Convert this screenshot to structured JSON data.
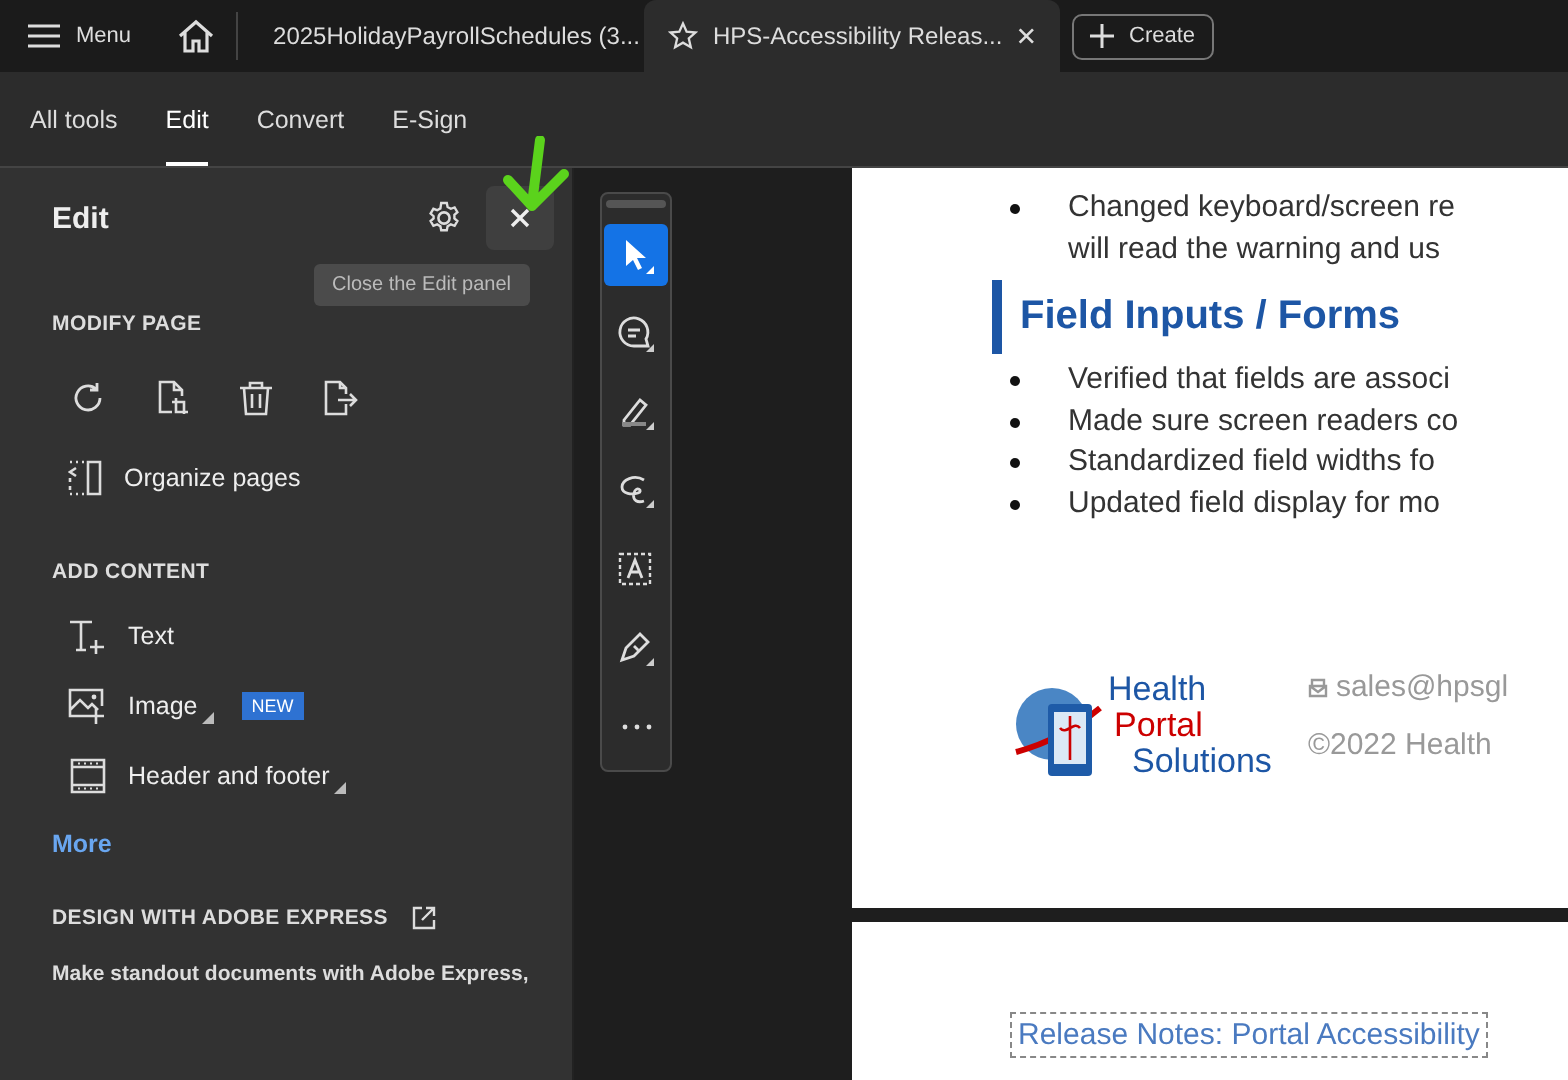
{
  "top_bar": {
    "menu": "Menu",
    "tabs": [
      {
        "label": "2025HolidayPayrollSchedules (3...",
        "selected": false
      },
      {
        "label": "HPS-Accessibility Releas...",
        "selected": true
      }
    ],
    "create": "Create"
  },
  "nav": [
    {
      "label": "All tools",
      "selected": false
    },
    {
      "label": "Edit",
      "selected": true
    },
    {
      "label": "Convert",
      "selected": false
    },
    {
      "label": "E-Sign",
      "selected": false
    }
  ],
  "panel": {
    "title": "Edit",
    "tooltip": "Close the Edit panel",
    "modify_heading": "MODIFY PAGE",
    "modify_tools": [
      {
        "kind": "rotate"
      },
      {
        "kind": "crop"
      },
      {
        "kind": "delete"
      },
      {
        "kind": "extract"
      }
    ],
    "organize": "Organize pages",
    "add_heading": "ADD CONTENT",
    "add_items": [
      {
        "kind": "text",
        "label": "Text",
        "caret": false
      },
      {
        "kind": "image",
        "label": "Image",
        "caret": true,
        "badge": "NEW"
      },
      {
        "kind": "header-footer",
        "label": "Header and footer",
        "caret": true
      }
    ],
    "more": "More",
    "express_heading": "DESIGN WITH ADOBE EXPRESS",
    "express_text": "Make standout documents with Adobe Express,"
  },
  "tools": [
    {
      "kind": "select",
      "selected": true
    },
    {
      "kind": "comment",
      "selected": false
    },
    {
      "kind": "highlight",
      "selected": false
    },
    {
      "kind": "draw",
      "selected": false
    },
    {
      "kind": "text-select",
      "selected": false
    },
    {
      "kind": "sign",
      "selected": false
    },
    {
      "kind": "more",
      "selected": false
    }
  ],
  "document": {
    "top_lines": [
      "Changed keyboard/screen re",
      "will read the warning and us"
    ],
    "heading": "Field Inputs / Forms",
    "bullets": [
      "Verified that fields are associ",
      "Made sure screen readers co",
      "Standardized field widths fo",
      "Updated field display for mo"
    ],
    "logo": [
      "Health",
      "Portal",
      "Solutions"
    ],
    "email": "sales@hpsgl",
    "copyright": "©2022 Health",
    "page2_title": "Release Notes: Portal Accessibility"
  }
}
